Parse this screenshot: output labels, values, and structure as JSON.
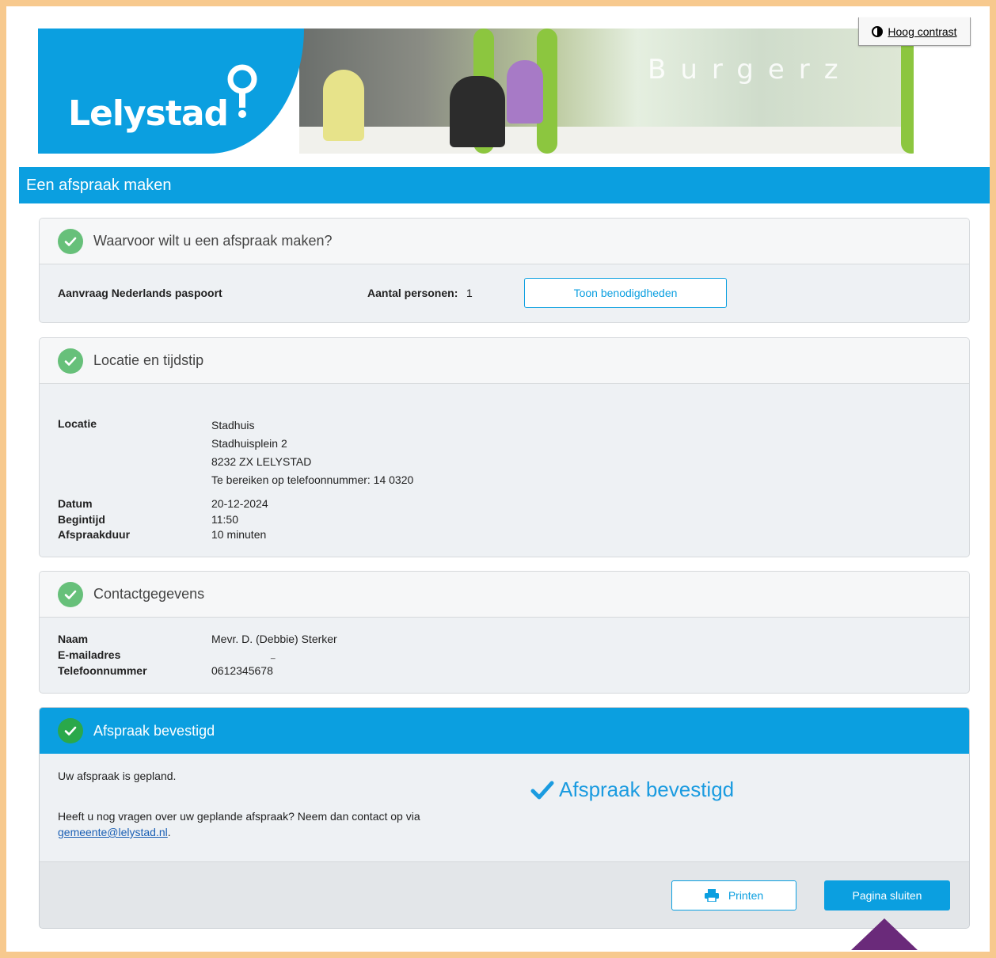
{
  "header": {
    "logo_text": "Lelystad",
    "photo_sign": "Burgerz",
    "high_contrast_label": "Hoog contrast"
  },
  "page_title": "Een afspraak maken",
  "section_service": {
    "title": "Waarvoor wilt u een afspraak maken?",
    "service_name": "Aanvraag Nederlands paspoort",
    "persons_label": "Aantal personen:",
    "persons_value": "1",
    "requirements_button": "Toon benodigdheden"
  },
  "section_location": {
    "title": "Locatie en tijdstip",
    "location_label": "Locatie",
    "location_lines": [
      "Stadhuis",
      "Stadhuisplein 2",
      "8232 ZX LELYSTAD",
      "Te bereiken op telefoonnummer: 14 0320"
    ],
    "date_label": "Datum",
    "date_value": "20-12-2024",
    "start_label": "Begintijd",
    "start_value": "11:50",
    "duration_label": "Afspraakduur",
    "duration_value": "10 minuten"
  },
  "section_contact": {
    "title": "Contactgegevens",
    "name_label": "Naam",
    "name_value": "Mevr. D. (Debbie) Sterker",
    "email_label": "E-mailadres",
    "email_value": "_",
    "phone_label": "Telefoonnummer",
    "phone_value": "0612345678"
  },
  "section_confirmed": {
    "title": "Afspraak bevestigd",
    "planned_text": "Uw afspraak is gepland.",
    "question_text": "Heeft u nog vragen over uw geplande afspraak? Neem dan contact op via",
    "email_link": "gemeente@lelystad.nl",
    "period": ".",
    "confirmed_big": "Afspraak bevestigd",
    "print_button": "Printen",
    "close_button": "Pagina sluiten"
  },
  "colors": {
    "brand_blue": "#0b9fe0",
    "check_green": "#67c07a",
    "frame_orange": "#f7c98e",
    "accent_purple": "#6a2a7a"
  }
}
